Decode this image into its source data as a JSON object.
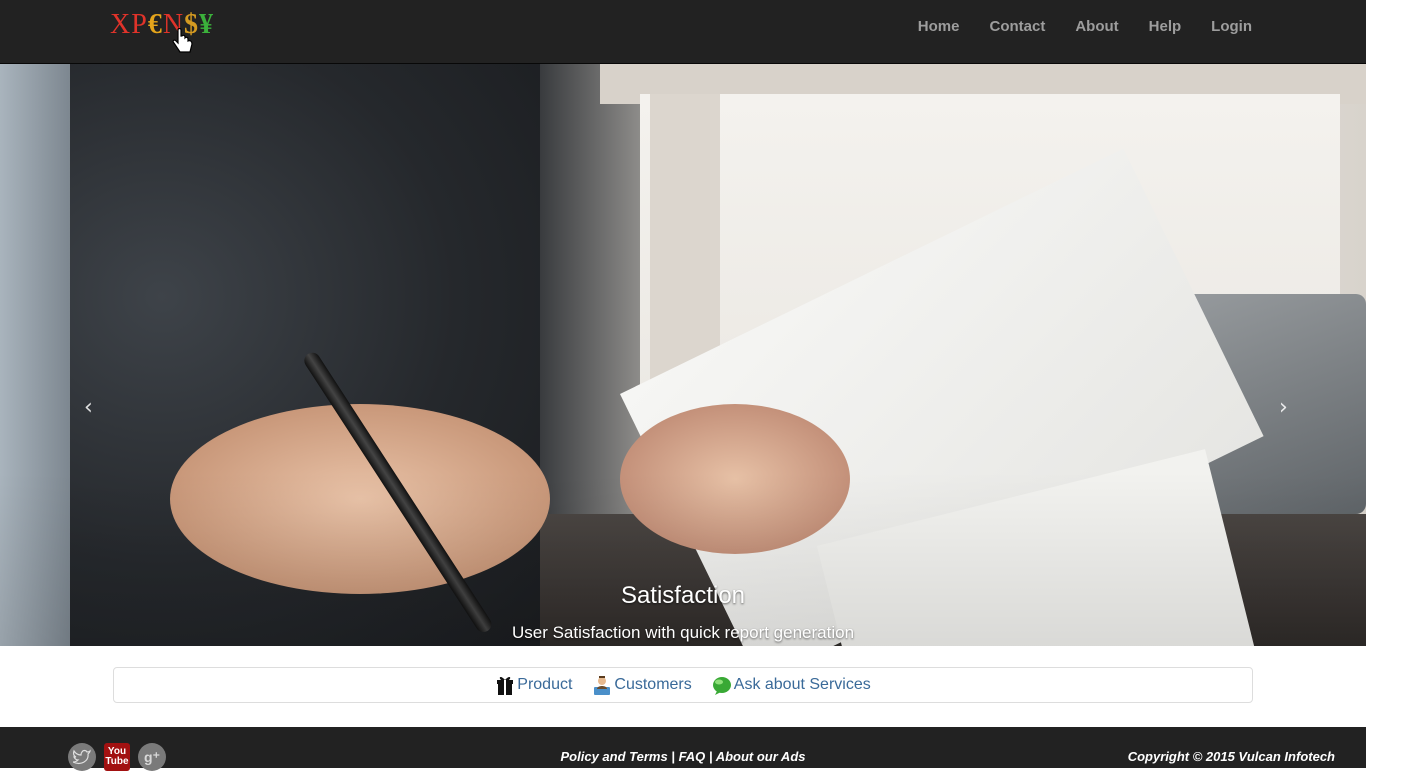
{
  "logo": {
    "letters": [
      "X",
      "P",
      "€",
      "N",
      "$",
      "¥"
    ],
    "colors": [
      "#e0332a",
      "#e0332a",
      "#e5a51b",
      "#e0332a",
      "#d49a21",
      "#3bb03b"
    ]
  },
  "nav": {
    "items": [
      "Home",
      "Contact",
      "About",
      "Help",
      "Login"
    ]
  },
  "carousel": {
    "title": "Satisfaction",
    "subtitle": "User Satisfaction with quick report generation",
    "prev_glyph": "‹",
    "next_glyph": "›",
    "slide_count": 3,
    "active_slide": 2
  },
  "services": {
    "items": [
      {
        "label": "Product",
        "icon": "gift-box-icon"
      },
      {
        "label": "Customers",
        "icon": "customer-icon"
      },
      {
        "label": "Ask about Services",
        "icon": "services-bubble-icon"
      }
    ]
  },
  "footer": {
    "social": [
      "twitter-icon",
      "youtube-icon",
      "google-plus-icon"
    ],
    "youtube_top": "You",
    "youtube_bottom": "Tube",
    "googleplus_text": "g⁺",
    "links": [
      "Policy and Terms",
      "FAQ",
      "About our Ads"
    ],
    "separator": "|",
    "copyright": "Copyright © 2015 Vulcan Infotech"
  }
}
